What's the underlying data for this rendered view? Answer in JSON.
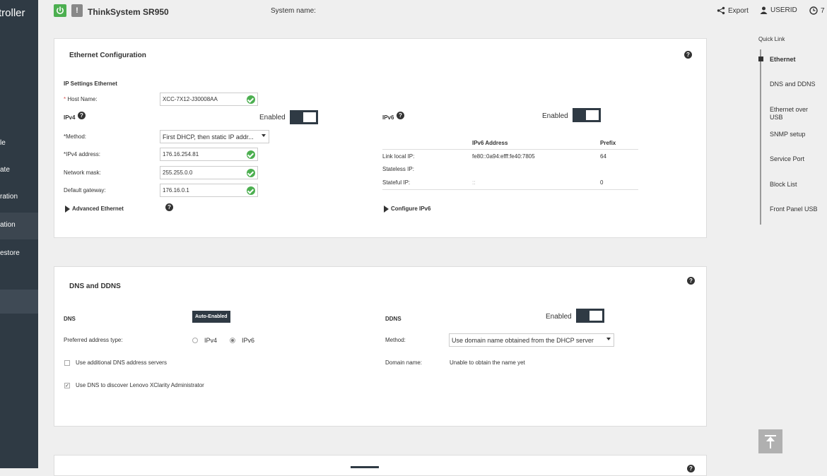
{
  "sidebar": {
    "brand": "troller",
    "items": [
      {
        "label": "le"
      },
      {
        "label": "ate"
      },
      {
        "label": "ration"
      },
      {
        "label": "ation"
      },
      {
        "label": "estore"
      }
    ]
  },
  "topbar": {
    "model": "ThinkSystem SR950",
    "system_name_label": "System name:",
    "export_label": "Export",
    "user_label": "USERID",
    "clock_label": "7"
  },
  "ethernet": {
    "title": "Ethernet Configuration",
    "section_title": "IP Settings Ethernet",
    "host_name_label": "Host Name:",
    "host_name_value": "XCC-7X12-J30008AA",
    "ipv4_label": "IPv4",
    "ipv4_enabled_label": "Enabled",
    "method_label": "*Method:",
    "method_value": "First DHCP, then static IP addr...",
    "ipv4_address_label": "*IPv4 address:",
    "ipv4_address_value": "176.16.254.81",
    "netmask_label": "Network mask:",
    "netmask_value": "255.255.0.0",
    "gateway_label": "Default gateway:",
    "gateway_value": "176.16.0.1",
    "advanced_label": "Advanced Ethernet",
    "ipv6_label": "IPv6",
    "ipv6_enabled_label": "Enabled",
    "ipv6_table": {
      "headers": [
        "IPv6 Address",
        "Prefix"
      ],
      "rows": [
        {
          "label": "Link local IP:",
          "address": "fe80::0a94:efff:fe40:7805",
          "prefix": "64"
        },
        {
          "label": "Stateless IP:",
          "address": "",
          "prefix": ""
        },
        {
          "label": "Stateful IP:",
          "address": "::",
          "prefix": "0"
        }
      ]
    },
    "configure_ipv6_label": "Configure IPv6"
  },
  "dns": {
    "title": "DNS and DDNS",
    "dns_label": "DNS",
    "auto_enabled_label": "Auto-Enabled",
    "preferred_label": "Preferred address type:",
    "radio_ipv4": "IPv4",
    "radio_ipv6": "IPv6",
    "additional_label": "Use additional DNS address servers",
    "discover_label": "Use DNS to discover Lenovo XClarity Administrator",
    "ddns_label": "DDNS",
    "ddns_enabled_label": "Enabled",
    "method_label": "Method:",
    "method_value": "Use domain name obtained from the DHCP server",
    "domain_label": "Domain name:",
    "domain_value": "Unable to obtain the name yet"
  },
  "quick_link": {
    "title": "Quick Link",
    "items": [
      {
        "label": "Ethernet"
      },
      {
        "label": "DNS and DDNS"
      },
      {
        "label": "Ethernet over USB"
      },
      {
        "label": "SNMP setup"
      },
      {
        "label": "Service Port"
      },
      {
        "label": "Block List"
      },
      {
        "label": "Front Panel USB"
      }
    ]
  },
  "icons": [
    "power-icon",
    "warning-icon",
    "share-icon",
    "user-icon",
    "clock-icon",
    "help-icon",
    "check-icon",
    "caret-right-icon",
    "back-to-top-icon"
  ]
}
